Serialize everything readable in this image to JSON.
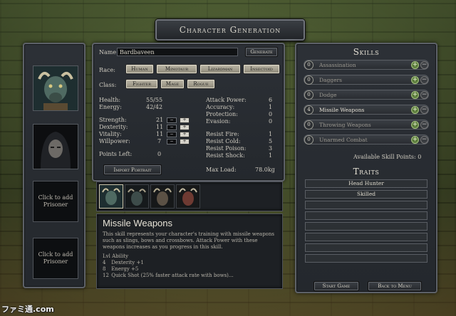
{
  "title": "Character Generation",
  "party": {
    "empty_slot_1": "Click to add Prisoner",
    "empty_slot_2": "Click to add Prisoner"
  },
  "character": {
    "name_label": "Name:",
    "name_value": "Bardbaveen",
    "generate_button": "Generate",
    "race_label": "Race:",
    "races": [
      "Human",
      "Minotaur",
      "Lizardman",
      "Insectoid"
    ],
    "selected_race": "Minotaur",
    "class_label": "Class:",
    "classes": [
      "Fighter",
      "Mage",
      "Rogue"
    ],
    "selected_class": "Rogue",
    "health_label": "Health:",
    "health_value": "55/55",
    "energy_label": "Energy:",
    "energy_value": "42/42",
    "strength_label": "Strength:",
    "strength_value": "21",
    "dexterity_label": "Dexterity:",
    "dexterity_value": "11",
    "vitality_label": "Vitality:",
    "vitality_value": "11",
    "willpower_label": "Willpower:",
    "willpower_value": "7",
    "points_left_label": "Points Left:",
    "points_left_value": "0",
    "import_portrait_button": "Import Portrait",
    "attack_power_label": "Attack Power:",
    "attack_power_value": "6",
    "accuracy_label": "Accuracy:",
    "accuracy_value": "1",
    "protection_label": "Protection:",
    "protection_value": "0",
    "evasion_label": "Evasion:",
    "evasion_value": "0",
    "resist_fire_label": "Resist Fire:",
    "resist_fire_value": "1",
    "resist_cold_label": "Resist Cold:",
    "resist_cold_value": "5",
    "resist_poison_label": "Resist Poison:",
    "resist_poison_value": "3",
    "resist_shock_label": "Resist Shock:",
    "resist_shock_value": "1",
    "max_load_label": "Max Load:",
    "max_load_value": "78.0kg"
  },
  "description": {
    "title": "Missile Weapons",
    "body": "This skill represents your character's training with missile weapons such as slings, bows and crossbows. Attack Power with these weapons increases as you progress in this skill.",
    "level_header": "Lvl Ability",
    "rows": [
      {
        "lvl": "4",
        "text": "Dexterity +1"
      },
      {
        "lvl": "8",
        "text": "Energy +5"
      },
      {
        "lvl": "12",
        "text": "Quick Shot (25% faster attack rate with bows)..."
      }
    ]
  },
  "skills": {
    "title": "Skills",
    "items": [
      {
        "level": "0",
        "name": "Assassination",
        "active": false
      },
      {
        "level": "0",
        "name": "Daggers",
        "active": false
      },
      {
        "level": "0",
        "name": "Dodge",
        "active": false
      },
      {
        "level": "4",
        "name": "Missile Weapons",
        "active": true
      },
      {
        "level": "0",
        "name": "Throwing Weapons",
        "active": false
      },
      {
        "level": "0",
        "name": "Unarmed Combat",
        "active": false
      }
    ],
    "available_points": "Available Skill Points: 0"
  },
  "traits": {
    "title": "Traits",
    "items": [
      "Head Hunter",
      "Skilled",
      "",
      "",
      "",
      "",
      "",
      ""
    ]
  },
  "buttons": {
    "start_game": "Start Game",
    "back_to_menu": "Back to Menu"
  },
  "watermark": "ファミ通.com"
}
